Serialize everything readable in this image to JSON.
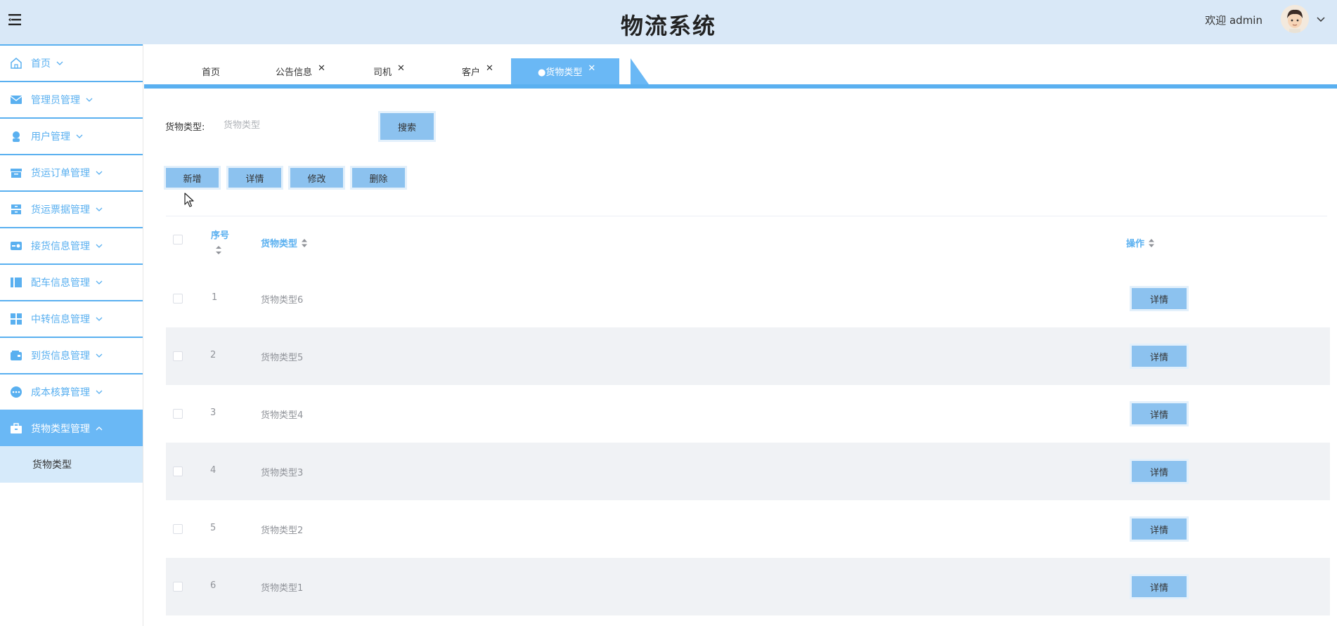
{
  "header": {
    "title": "物流系统",
    "welcome": "欢迎 admin"
  },
  "sidebar": {
    "items": [
      {
        "label": "首页",
        "icon": "home-icon"
      },
      {
        "label": "管理员管理",
        "icon": "envelope-icon"
      },
      {
        "label": "用户管理",
        "icon": "user-icon"
      },
      {
        "label": "货运订单管理",
        "icon": "order-icon"
      },
      {
        "label": "货运票据管理",
        "icon": "receipt-icon"
      },
      {
        "label": "接货信息管理",
        "icon": "receive-icon"
      },
      {
        "label": "配车信息管理",
        "icon": "vehicle-icon"
      },
      {
        "label": "中转信息管理",
        "icon": "grid-icon"
      },
      {
        "label": "到货信息管理",
        "icon": "wallet-icon"
      },
      {
        "label": "成本核算管理",
        "icon": "more-icon"
      },
      {
        "label": "货物类型管理",
        "icon": "briefcase-icon"
      }
    ],
    "submenu": {
      "label": "货物类型"
    }
  },
  "tabs": [
    {
      "label": "首页",
      "closable": false
    },
    {
      "label": "公告信息",
      "closable": true
    },
    {
      "label": "司机",
      "closable": true
    },
    {
      "label": "客户",
      "closable": true
    },
    {
      "label": "●货物类型",
      "closable": true,
      "active": true
    }
  ],
  "search": {
    "label": "货物类型:",
    "placeholder": "货物类型",
    "button": "搜索"
  },
  "toolbar": {
    "add": "新增",
    "detail": "详情",
    "edit": "修改",
    "delete": "删除"
  },
  "table": {
    "columns": [
      "序号",
      "货物类型",
      "操作"
    ],
    "rows": [
      {
        "index": "1",
        "type": "货物类型6",
        "action": "详情"
      },
      {
        "index": "2",
        "type": "货物类型5",
        "action": "详情"
      },
      {
        "index": "3",
        "type": "货物类型4",
        "action": "详情"
      },
      {
        "index": "4",
        "type": "货物类型3",
        "action": "详情"
      },
      {
        "index": "5",
        "type": "货物类型2",
        "action": "详情"
      },
      {
        "index": "6",
        "type": "货物类型1",
        "action": "详情"
      }
    ]
  },
  "colors": {
    "accent": "#5ab0f0",
    "header_bg": "#d9e8f7",
    "button_bg": "#8cc2ef",
    "active_menu": "#6ab8f5"
  }
}
